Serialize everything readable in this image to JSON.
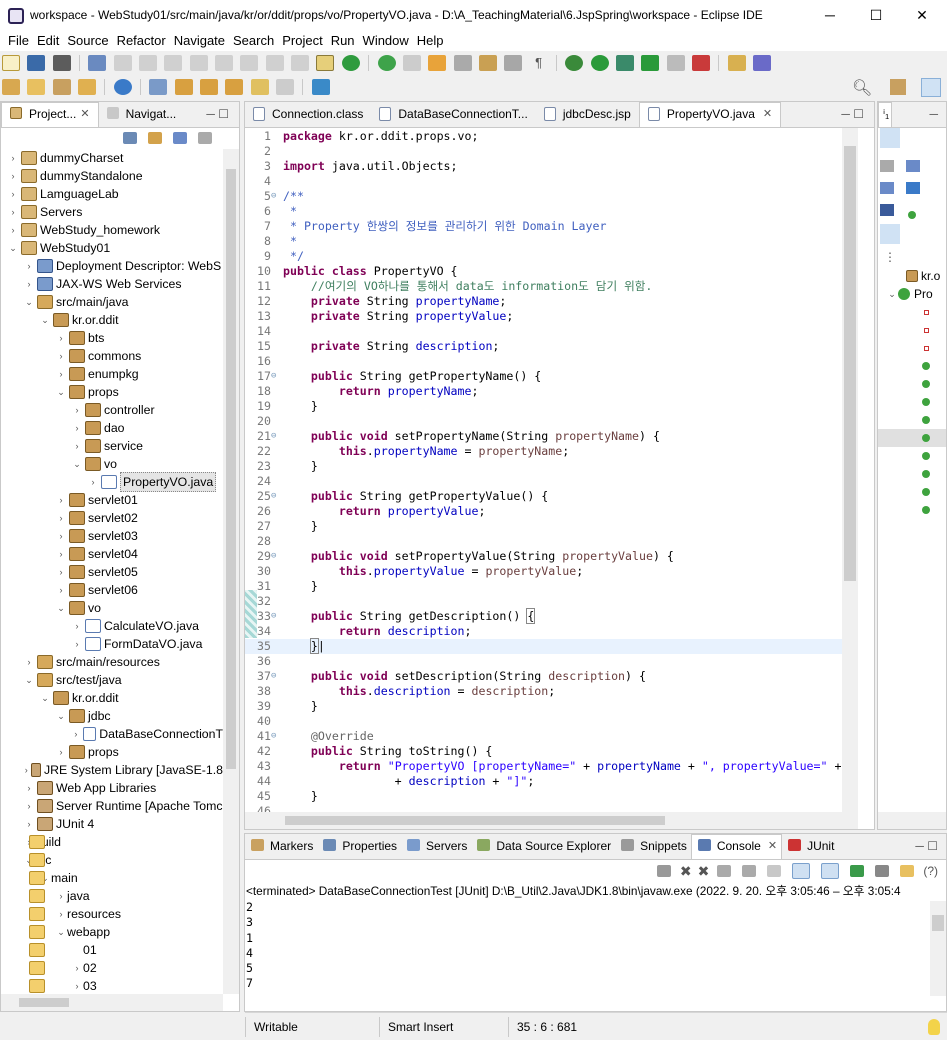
{
  "window": {
    "title": "workspace - WebStudy01/src/main/java/kr/or/ddit/props/vo/PropertyVO.java - D:\\A_TeachingMaterial\\6.JspSpring\\workspace - Eclipse IDE",
    "minimize": "─",
    "maximize": "☐",
    "close": "✕"
  },
  "menu": [
    "File",
    "Edit",
    "Source",
    "Refactor",
    "Navigate",
    "Search",
    "Project",
    "Run",
    "Window",
    "Help"
  ],
  "explorer": {
    "tabs": [
      {
        "label": "Project...",
        "close": "✕"
      },
      {
        "label": "Navigat...",
        "close": ""
      }
    ],
    "tree": [
      {
        "label": "dummyCharset",
        "depth": 0,
        "arrow": "›",
        "icon": "proj"
      },
      {
        "label": "dummyStandalone",
        "depth": 0,
        "arrow": "›",
        "icon": "proj"
      },
      {
        "label": "LamguageLab",
        "depth": 0,
        "arrow": "›",
        "icon": "proj"
      },
      {
        "label": "Servers",
        "depth": 0,
        "arrow": "›",
        "icon": "proj"
      },
      {
        "label": "WebStudy_homework",
        "depth": 0,
        "arrow": "›",
        "icon": "proj"
      },
      {
        "label": "WebStudy01",
        "depth": 0,
        "arrow": "⌄",
        "icon": "proj"
      },
      {
        "label": "Deployment Descriptor: WebS",
        "depth": 1,
        "arrow": "›",
        "icon": "srv"
      },
      {
        "label": "JAX-WS Web Services",
        "depth": 1,
        "arrow": "›",
        "icon": "srv"
      },
      {
        "label": "src/main/java",
        "depth": 1,
        "arrow": "⌄",
        "icon": "src"
      },
      {
        "label": "kr.or.ddit",
        "depth": 2,
        "arrow": "⌄",
        "icon": "pkg"
      },
      {
        "label": "bts",
        "depth": 3,
        "arrow": "›",
        "icon": "pkg"
      },
      {
        "label": "commons",
        "depth": 3,
        "arrow": "›",
        "icon": "pkg"
      },
      {
        "label": "enumpkg",
        "depth": 3,
        "arrow": "›",
        "icon": "pkg"
      },
      {
        "label": "props",
        "depth": 3,
        "arrow": "⌄",
        "icon": "pkg"
      },
      {
        "label": "controller",
        "depth": 4,
        "arrow": "›",
        "icon": "pkg"
      },
      {
        "label": "dao",
        "depth": 4,
        "arrow": "›",
        "icon": "pkg"
      },
      {
        "label": "service",
        "depth": 4,
        "arrow": "›",
        "icon": "pkg"
      },
      {
        "label": "vo",
        "depth": 4,
        "arrow": "⌄",
        "icon": "pkg"
      },
      {
        "label": "PropertyVO.java",
        "depth": 5,
        "arrow": "›",
        "icon": "java",
        "selected": true
      },
      {
        "label": "servlet01",
        "depth": 3,
        "arrow": "›",
        "icon": "pkg"
      },
      {
        "label": "servlet02",
        "depth": 3,
        "arrow": "›",
        "icon": "pkg"
      },
      {
        "label": "servlet03",
        "depth": 3,
        "arrow": "›",
        "icon": "pkg"
      },
      {
        "label": "servlet04",
        "depth": 3,
        "arrow": "›",
        "icon": "pkg"
      },
      {
        "label": "servlet05",
        "depth": 3,
        "arrow": "›",
        "icon": "pkg"
      },
      {
        "label": "servlet06",
        "depth": 3,
        "arrow": "›",
        "icon": "pkg"
      },
      {
        "label": "vo",
        "depth": 3,
        "arrow": "⌄",
        "icon": "pkg"
      },
      {
        "label": "CalculateVO.java",
        "depth": 4,
        "arrow": "›",
        "icon": "java"
      },
      {
        "label": "FormDataVO.java",
        "depth": 4,
        "arrow": "›",
        "icon": "java"
      },
      {
        "label": "src/main/resources",
        "depth": 1,
        "arrow": "›",
        "icon": "src"
      },
      {
        "label": "src/test/java",
        "depth": 1,
        "arrow": "⌄",
        "icon": "src"
      },
      {
        "label": "kr.or.ddit",
        "depth": 2,
        "arrow": "⌄",
        "icon": "pkg"
      },
      {
        "label": "jdbc",
        "depth": 3,
        "arrow": "⌄",
        "icon": "pkg"
      },
      {
        "label": "DataBaseConnectionT",
        "depth": 4,
        "arrow": "›",
        "icon": "java"
      },
      {
        "label": "props",
        "depth": 3,
        "arrow": "›",
        "icon": "pkg"
      },
      {
        "label": "JRE System Library [JavaSE-1.8",
        "depth": 1,
        "arrow": "›",
        "icon": "lib"
      },
      {
        "label": "Web App Libraries",
        "depth": 1,
        "arrow": "›",
        "icon": "lib"
      },
      {
        "label": "Server Runtime [Apache Tomc",
        "depth": 1,
        "arrow": "›",
        "icon": "lib"
      },
      {
        "label": "JUnit 4",
        "depth": 1,
        "arrow": "›",
        "icon": "lib"
      },
      {
        "label": "build",
        "depth": 1,
        "arrow": "›",
        "icon": "fold"
      },
      {
        "label": "src",
        "depth": 1,
        "arrow": "⌄",
        "icon": "fold"
      },
      {
        "label": "main",
        "depth": 2,
        "arrow": "⌄",
        "icon": "fold"
      },
      {
        "label": "java",
        "depth": 3,
        "arrow": "›",
        "icon": "fold"
      },
      {
        "label": "resources",
        "depth": 3,
        "arrow": "›",
        "icon": "fold"
      },
      {
        "label": "webapp",
        "depth": 3,
        "arrow": "⌄",
        "icon": "fold"
      },
      {
        "label": "01",
        "depth": 4,
        "arrow": "",
        "icon": "fold"
      },
      {
        "label": "02",
        "depth": 4,
        "arrow": "›",
        "icon": "fold"
      },
      {
        "label": "03",
        "depth": 4,
        "arrow": "›",
        "icon": "fold"
      }
    ]
  },
  "editor": {
    "tabs": [
      {
        "label": "Connection.class",
        "active": false,
        "close": ""
      },
      {
        "label": "DataBaseConnectionT...",
        "active": false,
        "close": ""
      },
      {
        "label": "jdbcDesc.jsp",
        "active": false,
        "close": ""
      },
      {
        "label": "PropertyVO.java",
        "active": true,
        "close": "✕"
      }
    ],
    "lines": [
      {
        "n": "1",
        "html": "<span class='kw'>package</span> kr.or.ddit.props.vo;"
      },
      {
        "n": "2",
        "html": ""
      },
      {
        "n": "3",
        "html": "<span class='kw'>import</span> java.util.Objects;"
      },
      {
        "n": "4",
        "html": ""
      },
      {
        "n": "5",
        "fold": true,
        "html": "<span class='jd'>/**</span>"
      },
      {
        "n": "6",
        "html": "<span class='jd'> *</span>"
      },
      {
        "n": "7",
        "html": "<span class='jd'> * Property 한쌍의 정보를 관리하기 위한 Domain Layer</span>"
      },
      {
        "n": "8",
        "html": "<span class='jd'> *</span>"
      },
      {
        "n": "9",
        "html": "<span class='jd'> */</span>"
      },
      {
        "n": "10",
        "html": "<span class='kw'>public class</span> PropertyVO {"
      },
      {
        "n": "11",
        "html": "    <span class='cmt'>//여기의 VO하나를 통해서 data도 information도 담기 위함.</span>"
      },
      {
        "n": "12",
        "html": "    <span class='kw'>private</span> String <span class='fld'>propertyName</span>;"
      },
      {
        "n": "13",
        "html": "    <span class='kw'>private</span> String <span class='fld'>propertyValue</span>;"
      },
      {
        "n": "14",
        "html": ""
      },
      {
        "n": "15",
        "html": "    <span class='kw'>private</span> String <span class='fld'>description</span>;"
      },
      {
        "n": "16",
        "html": ""
      },
      {
        "n": "17",
        "fold": true,
        "html": "    <span class='kw'>public</span> String getPropertyName() {"
      },
      {
        "n": "18",
        "html": "        <span class='kw'>return</span> <span class='fld'>propertyName</span>;"
      },
      {
        "n": "19",
        "html": "    }"
      },
      {
        "n": "20",
        "html": ""
      },
      {
        "n": "21",
        "fold": true,
        "html": "    <span class='kw'>public void</span> setPropertyName(String <span class='par'>propertyName</span>) {"
      },
      {
        "n": "22",
        "html": "        <span class='kw'>this</span>.<span class='fld'>propertyName</span> = <span class='par'>propertyName</span>;"
      },
      {
        "n": "23",
        "html": "    }"
      },
      {
        "n": "24",
        "html": ""
      },
      {
        "n": "25",
        "fold": true,
        "html": "    <span class='kw'>public</span> String getPropertyValue() {"
      },
      {
        "n": "26",
        "html": "        <span class='kw'>return</span> <span class='fld'>propertyValue</span>;"
      },
      {
        "n": "27",
        "html": "    }"
      },
      {
        "n": "28",
        "html": ""
      },
      {
        "n": "29",
        "fold": true,
        "html": "    <span class='kw'>public void</span> setPropertyValue(String <span class='par'>propertyValue</span>) {"
      },
      {
        "n": "30",
        "html": "        <span class='kw'>this</span>.<span class='fld'>propertyValue</span> = <span class='par'>propertyValue</span>;"
      },
      {
        "n": "31",
        "html": "    }"
      },
      {
        "n": "32",
        "html": ""
      },
      {
        "n": "33",
        "fold": true,
        "html": "    <span class='kw'>public</span> String getDescription() <span style='outline:1px solid #888'>{</span>"
      },
      {
        "n": "34",
        "html": "        <span class='kw'>return</span> <span class='fld'>description</span>;"
      },
      {
        "n": "35",
        "current": true,
        "html": "    <span style='outline:1px solid #888'>}</span>|"
      },
      {
        "n": "36",
        "html": ""
      },
      {
        "n": "37",
        "fold": true,
        "html": "    <span class='kw'>public void</span> setDescription(String <span class='par'>description</span>) {"
      },
      {
        "n": "38",
        "html": "        <span class='kw'>this</span>.<span class='fld'>description</span> = <span class='par'>description</span>;"
      },
      {
        "n": "39",
        "html": "    }"
      },
      {
        "n": "40",
        "html": ""
      },
      {
        "n": "41",
        "fold": true,
        "html": "    <span class='ann'>@Override</span>"
      },
      {
        "n": "42",
        "html": "    <span class='kw'>public</span> String toString() {"
      },
      {
        "n": "43",
        "html": "        <span class='kw'>return</span> <span class='str'>\"PropertyVO [propertyName=\"</span> + <span class='fld'>propertyName</span> + <span class='str'>\", propertyValue=\"</span> +"
      },
      {
        "n": "44",
        "html": "                + <span class='fld'>description</span> + <span class='str'>\"]\"</span>;"
      },
      {
        "n": "45",
        "html": "    }"
      },
      {
        "n": "46",
        "html": ""
      }
    ]
  },
  "bottom": {
    "tabs": [
      {
        "label": "Markers",
        "close": ""
      },
      {
        "label": "Properties",
        "close": ""
      },
      {
        "label": "Servers",
        "close": ""
      },
      {
        "label": "Data Source Explorer",
        "close": ""
      },
      {
        "label": "Snippets",
        "close": ""
      },
      {
        "label": "Console",
        "close": "✕"
      },
      {
        "label": "JUnit",
        "close": ""
      }
    ],
    "console_header": "<terminated> DataBaseConnectionTest [JUnit] D:\\B_Util\\2.Java\\JDK1.8\\bin\\javaw.exe  (2022. 9. 20. 오후 3:05:46 – 오후 3:05:4",
    "console_lines": [
      "2",
      "3",
      "1",
      "4",
      "5",
      "7"
    ]
  },
  "outline": {
    "top_items": [
      "kr.o",
      "Pro"
    ],
    "tab_label": "ⁱ₁"
  },
  "status": {
    "writable": "Writable",
    "insert": "Smart Insert",
    "position": "35 : 6 : 681"
  }
}
